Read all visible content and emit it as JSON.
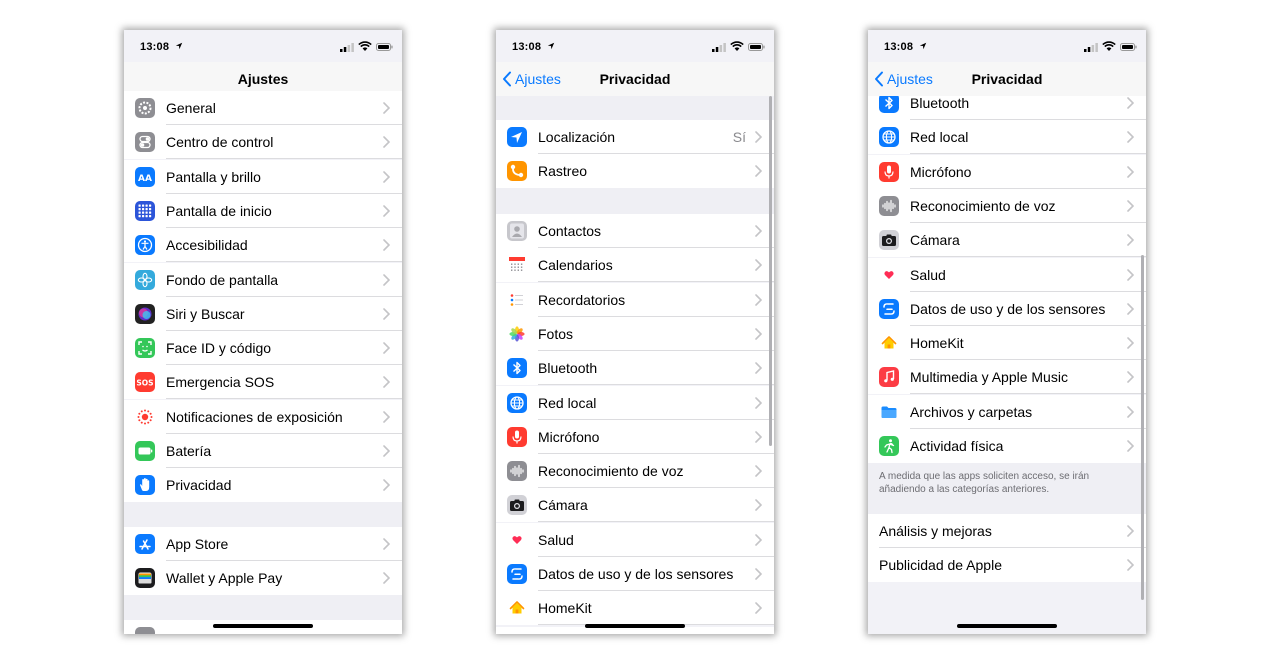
{
  "status": {
    "time": "13:08"
  },
  "phone1": {
    "title": "Ajustes",
    "items": [
      {
        "label": "General",
        "icon": "gear-icon",
        "color": "#8e8e93"
      },
      {
        "label": "Centro de control",
        "icon": "toggles-icon",
        "color": "#8e8e93"
      },
      {
        "label": "Pantalla y brillo",
        "icon": "text-size-icon",
        "color": "#0a7aff"
      },
      {
        "label": "Pantalla de inicio",
        "icon": "app-grid-icon",
        "color": "#2c55d9"
      },
      {
        "label": "Accesibilidad",
        "icon": "accessibility-icon",
        "color": "#0a7aff"
      },
      {
        "label": "Fondo de pantalla",
        "icon": "flower-icon",
        "color": "#34aadc"
      },
      {
        "label": "Siri y Buscar",
        "icon": "siri-icon",
        "color": "#222222"
      },
      {
        "label": "Face ID y código",
        "icon": "face-id-icon",
        "color": "#34c759"
      },
      {
        "label": "Emergencia SOS",
        "icon": "sos-icon",
        "color": "#ff3b30"
      },
      {
        "label": "Notificaciones de exposición",
        "icon": "exposure-icon",
        "color": "#ffffff"
      },
      {
        "label": "Batería",
        "icon": "battery-icon",
        "color": "#34c759"
      },
      {
        "label": "Privacidad",
        "icon": "hand-icon",
        "color": "#0a7aff"
      }
    ],
    "items2": [
      {
        "label": "App Store",
        "icon": "app-store-icon",
        "color": "#0a7aff"
      },
      {
        "label": "Wallet y Apple Pay",
        "icon": "wallet-icon",
        "color": "#1c1c1e"
      }
    ]
  },
  "phone2": {
    "back": "Ajustes",
    "title": "Privacidad",
    "location": {
      "label": "Localización",
      "value": "Sí"
    },
    "tracking": {
      "label": "Rastreo"
    },
    "items": [
      {
        "label": "Contactos",
        "icon": "contacts-icon",
        "color": "#c7c7cc"
      },
      {
        "label": "Calendarios",
        "icon": "calendar-icon",
        "color": "#ffffff"
      },
      {
        "label": "Recordatorios",
        "icon": "reminders-icon",
        "color": "#ffffff"
      },
      {
        "label": "Fotos",
        "icon": "photos-icon",
        "color": "#ffffff"
      },
      {
        "label": "Bluetooth",
        "icon": "bluetooth-icon",
        "color": "#0a7aff"
      },
      {
        "label": "Red local",
        "icon": "globe-icon",
        "color": "#0a7aff"
      },
      {
        "label": "Micrófono",
        "icon": "microphone-icon",
        "color": "#ff3b30"
      },
      {
        "label": "Reconocimiento de voz",
        "icon": "waveform-icon",
        "color": "#8e8e93"
      },
      {
        "label": "Cámara",
        "icon": "camera-icon",
        "color": "#d1d1d6"
      },
      {
        "label": "Salud",
        "icon": "heart-icon",
        "color": "#ffffff"
      },
      {
        "label": "Datos de uso y de los sensores",
        "icon": "sensor-icon",
        "color": "#0a7aff"
      },
      {
        "label": "HomeKit",
        "icon": "home-icon",
        "color": "#ffffff"
      }
    ]
  },
  "phone3": {
    "back": "Ajustes",
    "title": "Privacidad",
    "items": [
      {
        "label": "Bluetooth",
        "icon": "bluetooth-icon",
        "color": "#0a7aff"
      },
      {
        "label": "Red local",
        "icon": "globe-icon",
        "color": "#0a7aff"
      },
      {
        "label": "Micrófono",
        "icon": "microphone-icon",
        "color": "#ff3b30"
      },
      {
        "label": "Reconocimiento de voz",
        "icon": "waveform-icon",
        "color": "#8e8e93"
      },
      {
        "label": "Cámara",
        "icon": "camera-icon",
        "color": "#d1d1d6"
      },
      {
        "label": "Salud",
        "icon": "heart-icon",
        "color": "#ffffff"
      },
      {
        "label": "Datos de uso y de los sensores",
        "icon": "sensor-icon",
        "color": "#0a7aff"
      },
      {
        "label": "HomeKit",
        "icon": "home-icon",
        "color": "#ffffff"
      },
      {
        "label": "Multimedia y Apple Music",
        "icon": "music-icon",
        "color": "#fc3c44"
      },
      {
        "label": "Archivos y carpetas",
        "icon": "folder-icon",
        "color": "#ffffff"
      },
      {
        "label": "Actividad física",
        "icon": "fitness-icon",
        "color": "#34c759"
      }
    ],
    "footnote": "A medida que las apps soliciten acceso, se irán añadiendo a las categorías anteriores.",
    "items2": [
      {
        "label": "Análisis y mejoras"
      },
      {
        "label": "Publicidad de Apple"
      }
    ]
  }
}
